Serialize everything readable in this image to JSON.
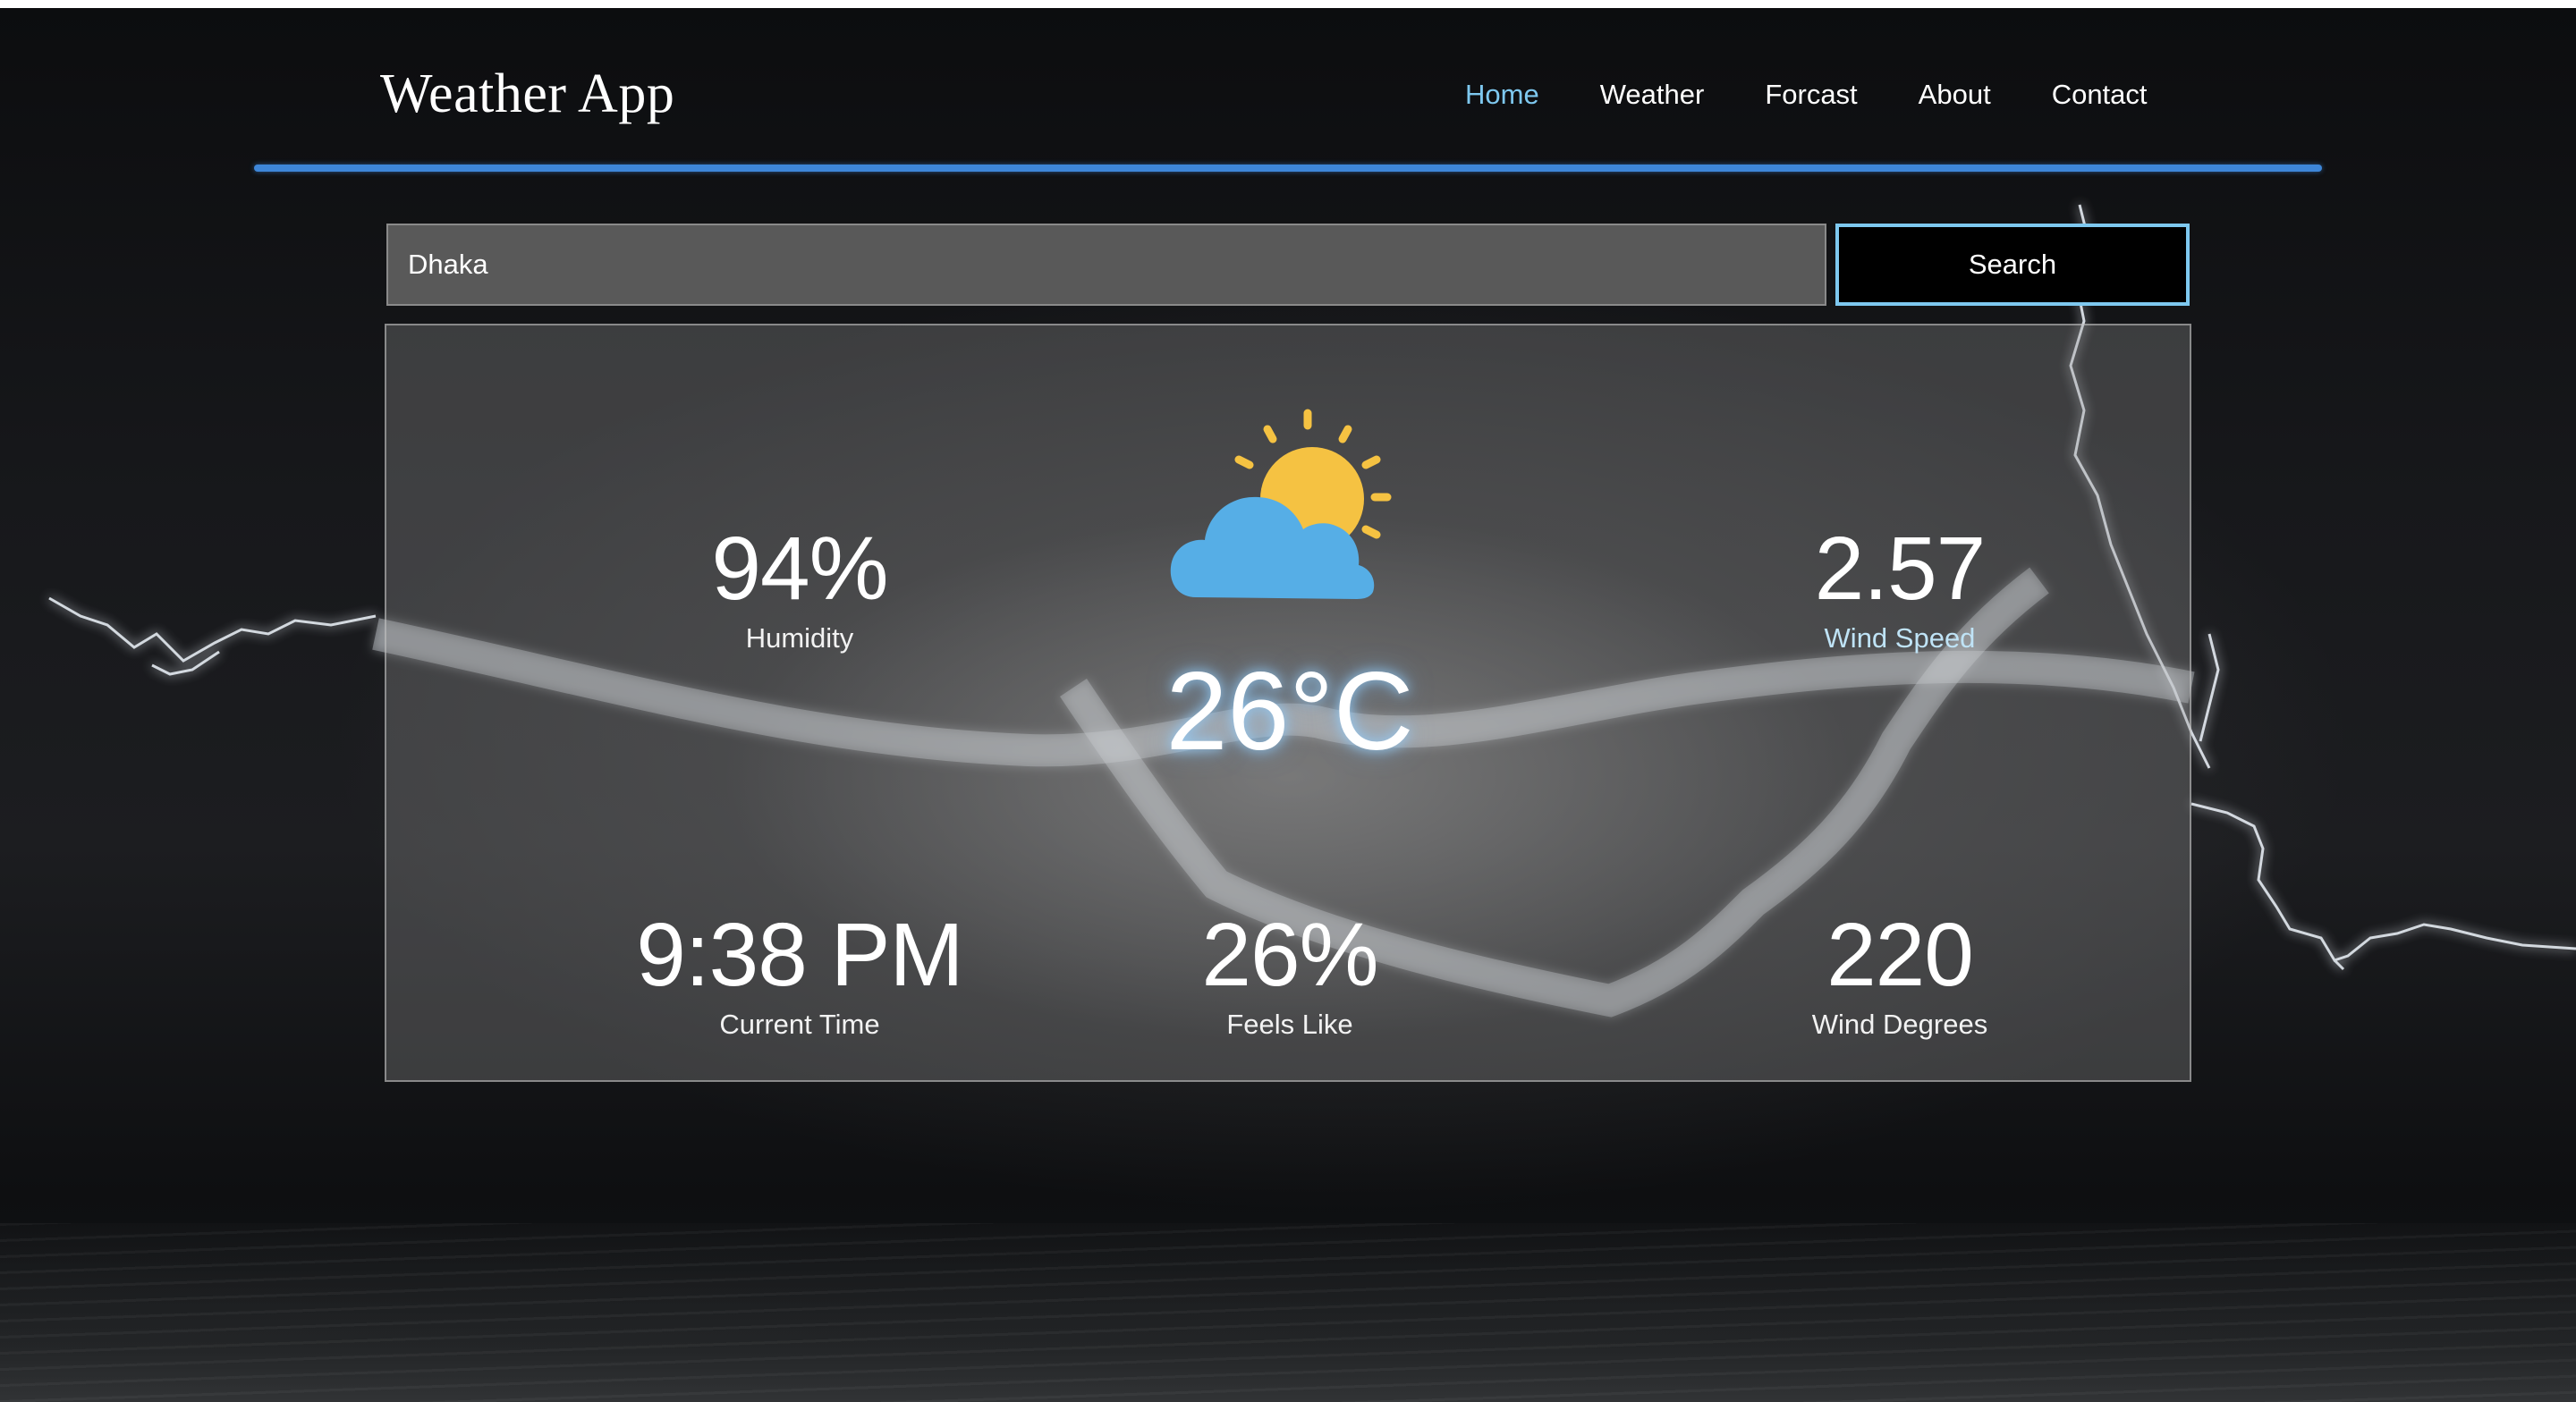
{
  "header": {
    "brand": "Weather App",
    "nav": [
      {
        "label": "Home",
        "active": true
      },
      {
        "label": "Weather",
        "active": false
      },
      {
        "label": "Forcast",
        "active": false
      },
      {
        "label": "About",
        "active": false
      },
      {
        "label": "Contact",
        "active": false
      }
    ]
  },
  "search": {
    "value": "Dhaka",
    "button_label": "Search"
  },
  "weather": {
    "icon": "partly-cloudy-day-icon",
    "temperature": "26°C",
    "humidity": {
      "value": "94%",
      "label": "Humidity"
    },
    "wind_speed": {
      "value": "2.57",
      "label": "Wind Speed"
    },
    "current_time": {
      "value": "9:38 PM",
      "label": "Current Time"
    },
    "feels_like": {
      "value": "26%",
      "label": "Feels Like"
    },
    "wind_degrees": {
      "value": "220",
      "label": "Wind Degrees"
    }
  },
  "colors": {
    "accent": "#3e86d8",
    "active_nav": "#7ec8ef",
    "sun": "#f5c242",
    "cloud": "#56aee6"
  }
}
